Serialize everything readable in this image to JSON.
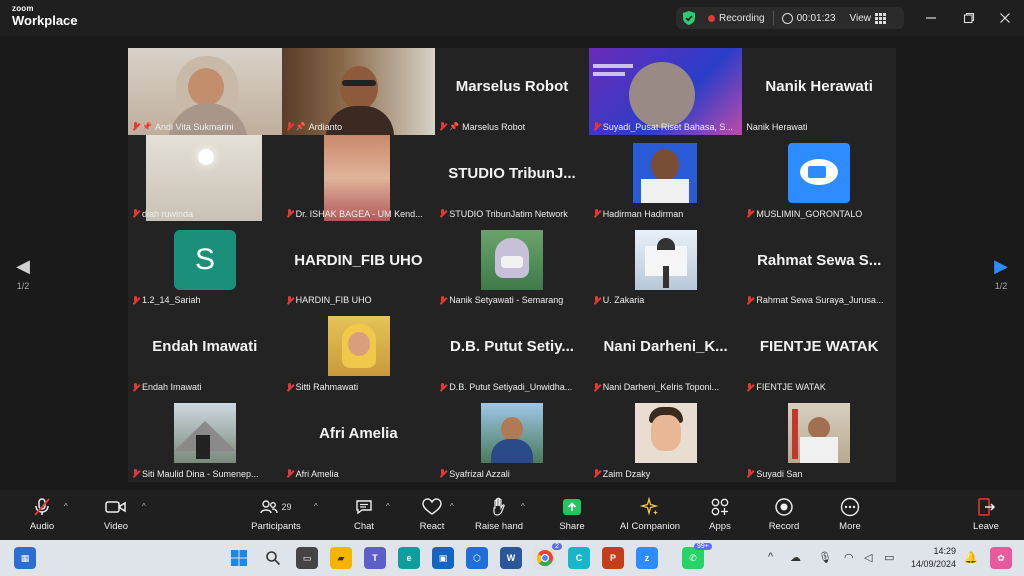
{
  "app": {
    "brand_small": "zoom",
    "brand_big": "Workplace"
  },
  "topbar": {
    "recording_label": "Recording",
    "timer": "00:01:23",
    "view_label": "View",
    "colors": {
      "shield": "#2ecc71",
      "rec": "#e53935"
    }
  },
  "pager": {
    "page_left": "1/2",
    "page_right": "1/2"
  },
  "tiles": [
    {
      "name": "Andi Vita Sukmarini",
      "big": "",
      "video": "woman-hijab",
      "pinned": true,
      "active": true
    },
    {
      "name": "Ardianto",
      "big": "",
      "video": "man-glasses",
      "pinned": true
    },
    {
      "name": "Marselus Robot",
      "big": "Marselus Robot",
      "video": "",
      "pinned": true
    },
    {
      "name": "Suyadi_Pusat Riset Bahasa, S...",
      "big": "",
      "video": "slide",
      "pinned": false
    },
    {
      "name": "Nanik Herawati",
      "big": "Nanik Herawati",
      "video": "",
      "pinned": false,
      "nomic": true
    },
    {
      "name": "diah ruwinda",
      "big": "",
      "video": "ceiling"
    },
    {
      "name": "Dr. ISHAK BAGEA - UM Kend...",
      "big": "",
      "video": "blurry"
    },
    {
      "name": "STUDIO TribunJatim Network",
      "big": "STUDIO TribunJ...",
      "video": ""
    },
    {
      "name": "Hadirman Hadirman",
      "big": "",
      "video": "portrait-blue"
    },
    {
      "name": "MUSLIMIN_GORONTALO",
      "big": "",
      "video": "zoom-logo"
    },
    {
      "name": "1.2_14_Sariah",
      "big": "",
      "video": "avatar-s",
      "avatar_letter": "S"
    },
    {
      "name": "HARDIN_FIB UHO",
      "big": "HARDIN_FIB UHO",
      "video": ""
    },
    {
      "name": "Nanik Setyawati - Semarang",
      "big": "",
      "video": "woman-mask"
    },
    {
      "name": "U. Zakaria",
      "big": "",
      "video": "mosque"
    },
    {
      "name": "Rahmat Sewa Suraya_Jurusa...",
      "big": "Rahmat Sewa S...",
      "video": ""
    },
    {
      "name": "Endah Imawati",
      "big": "Endah Imawati",
      "video": ""
    },
    {
      "name": "Sitti Rahmawati",
      "big": "",
      "video": "woman-yellow"
    },
    {
      "name": "D.B. Putut Setiyadi_Unwidha...",
      "big": "D.B. Putut Setiy...",
      "video": ""
    },
    {
      "name": "Nani Darheni_Kelris Toponi...",
      "big": "Nani Darheni_K...",
      "video": ""
    },
    {
      "name": "FIENTJE WATAK",
      "big": "FIENTJE WATAK",
      "video": ""
    },
    {
      "name": "Siti Maulid Dina - Sumenep...",
      "big": "",
      "video": "mountain"
    },
    {
      "name": "Afri Amelia",
      "big": "Afri Amelia",
      "video": ""
    },
    {
      "name": "Syafrizal Azzali",
      "big": "",
      "video": "man-outdoor"
    },
    {
      "name": "Zaim Dzaky",
      "big": "",
      "video": "cartoon"
    },
    {
      "name": "Suyadi San",
      "big": "",
      "video": "official"
    }
  ],
  "toolbar": {
    "audio": "Audio",
    "video": "Video",
    "participants": "Participants",
    "participants_count": "29",
    "chat": "Chat",
    "react": "React",
    "raise_hand": "Raise hand",
    "share": "Share",
    "ai_companion": "AI Companion",
    "apps": "Apps",
    "record": "Record",
    "more": "More",
    "leave": "Leave"
  },
  "taskbar": {
    "time": "14:29",
    "date": "14/09/2024",
    "chrome_badge": "2",
    "whatsapp_badge": "99+"
  }
}
